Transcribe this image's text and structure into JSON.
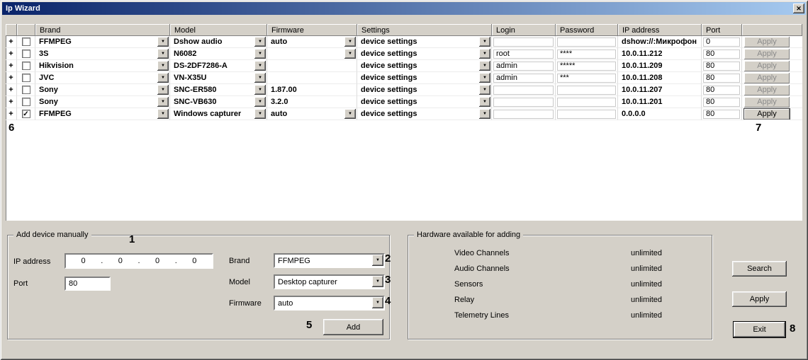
{
  "window": {
    "title": "Ip Wizard"
  },
  "icons": {
    "dropdown": "▼",
    "expand": "+",
    "check": "✓",
    "close": "✕"
  },
  "table": {
    "apply_label": "Apply",
    "headers": {
      "brand": "Brand",
      "model": "Model",
      "firmware": "Firmware",
      "settings": "Settings",
      "login": "Login",
      "password": "Password",
      "ip": "IP address",
      "port": "Port"
    },
    "rows": [
      {
        "checked": false,
        "brand": "FFMPEG",
        "model": "Dshow audio",
        "firmware": "auto",
        "settings": "device settings",
        "login": "",
        "password": "",
        "ip": "dshow://:Микрофон",
        "port": "0"
      },
      {
        "checked": false,
        "brand": "3S",
        "model": "N6082",
        "firmware": "",
        "settings": "device settings",
        "login": "root",
        "password": "****",
        "ip": "10.0.11.212",
        "port": "80"
      },
      {
        "checked": false,
        "brand": "Hikvision",
        "model": "DS-2DF7286-A",
        "firmware": "",
        "settings": "device settings",
        "login": "admin",
        "password": "*****",
        "ip": "10.0.11.209",
        "port": "80"
      },
      {
        "checked": false,
        "brand": "JVC",
        "model": "VN-X35U",
        "firmware": "",
        "settings": "device settings",
        "login": "admin",
        "password": "***",
        "ip": "10.0.11.208",
        "port": "80"
      },
      {
        "checked": false,
        "brand": "Sony",
        "model": "SNC-ER580",
        "firmware": "1.87.00",
        "settings": "device settings",
        "login": "",
        "password": "",
        "ip": "10.0.11.207",
        "port": "80"
      },
      {
        "checked": false,
        "brand": "Sony",
        "model": "SNC-VB630",
        "firmware": "3.2.0",
        "settings": "device settings",
        "login": "",
        "password": "",
        "ip": "10.0.11.201",
        "port": "80"
      },
      {
        "checked": true,
        "brand": "FFMPEG",
        "model": "Windows capturer",
        "firmware": "auto",
        "settings": "device settings",
        "login": "",
        "password": "",
        "ip": "0.0.0.0",
        "port": "80"
      }
    ]
  },
  "add_device": {
    "legend": "Add device manually",
    "ip_label": "IP address",
    "ip_octets": [
      "0",
      "0",
      "0",
      "0"
    ],
    "octet_separator": ".",
    "port_label": "Port",
    "port_value": "80",
    "brand_label": "Brand",
    "brand_value": "FFMPEG",
    "model_label": "Model",
    "model_value": "Desktop capturer",
    "firmware_label": "Firmware",
    "firmware_value": "auto",
    "add_button": "Add"
  },
  "hardware": {
    "legend": "Hardware available for adding",
    "items": [
      {
        "label": "Video Channels",
        "value": "unlimited"
      },
      {
        "label": "Audio Channels",
        "value": "unlimited"
      },
      {
        "label": "Sensors",
        "value": "unlimited"
      },
      {
        "label": "Relay",
        "value": "unlimited"
      },
      {
        "label": "Telemetry Lines",
        "value": "unlimited"
      }
    ]
  },
  "buttons": {
    "search": "Search",
    "apply": "Apply",
    "exit": "Exit"
  },
  "annotations": {
    "n1": "1",
    "n2": "2",
    "n3": "3",
    "n4": "4",
    "n5": "5",
    "n6": "6",
    "n7": "7",
    "n8": "8"
  }
}
